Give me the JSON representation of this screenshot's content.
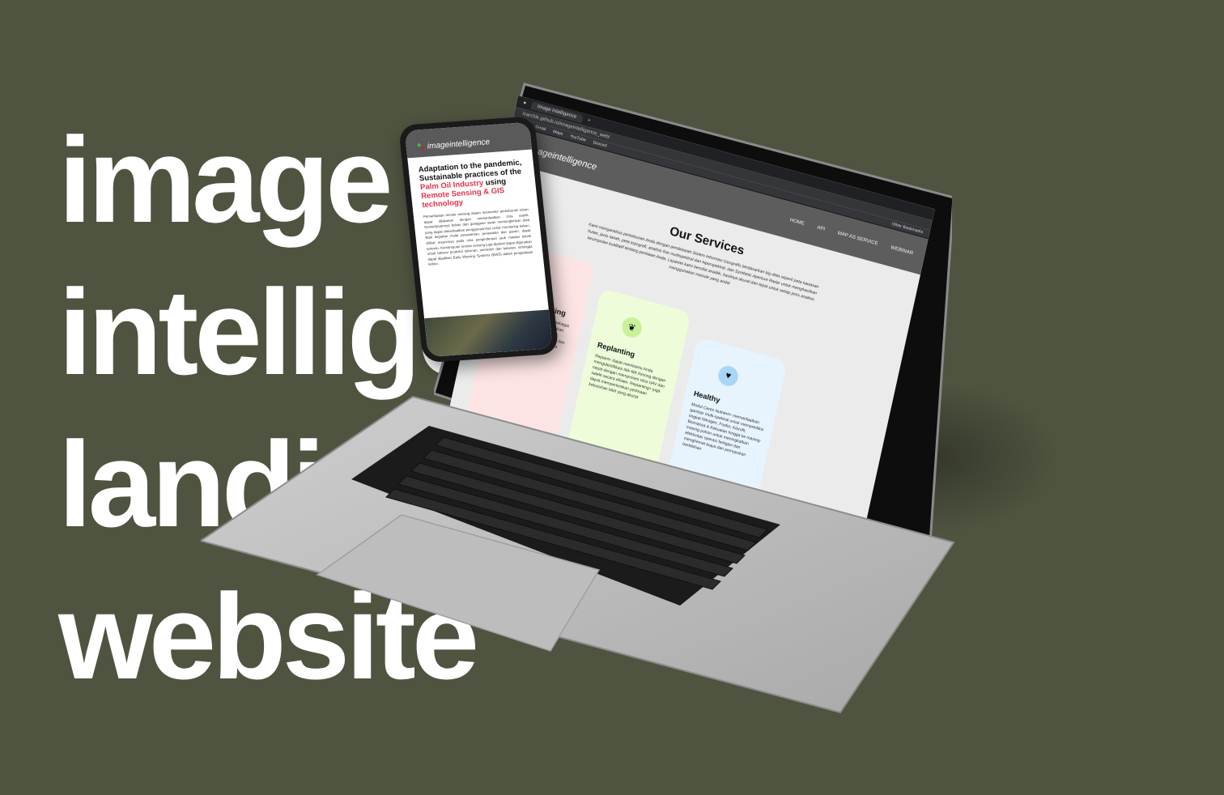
{
  "headline": {
    "lines": [
      "image",
      "intelligence",
      "landing page",
      "website"
    ]
  },
  "browser": {
    "tab_title": "Image Intelligence",
    "url": "icarchik.github.io/imageintelligence_web/",
    "bookmarks": [
      "Apps",
      "Gmail",
      "Maps",
      "YouTube",
      "Discord"
    ],
    "other_bookmarks": "Other Bookmarks"
  },
  "site": {
    "logo": "imageintelligence",
    "nav": [
      "HOME",
      "API",
      "MAP AS SERVICE",
      "WEBINAR"
    ],
    "services_title": "Our Services",
    "services_desc": "Kami menganalisis perkebunan Anda dengan pendekatan Sistem Informasi Geografis berdasarkan big data seperti peta kawasan hutan, jenis tanah, peta topografi, analisis foto multispektral dan hiperspektral, dan Synthetic Aperture Radar untuk menghasilkan kesimpulan kualitatif tentang penilaian Anda. Layanan kami bersifat analitik, hasilnya akurat dan tepat untuk setiap jenis analisis menggunakan metode yang andal",
    "cards": [
      {
        "title": "Agriforest Sensing",
        "text": "Agriforest Sensing adalah Peta sebagai layanan untuk mengimplementasikan citra UAV, citra satelit dan data Big Geospasial, untuk mengidentifikasi dan menandai setiap pohon unik secara akurat.",
        "color": "#fde4e4",
        "icon_color": "#f4a9a9",
        "icon": "satellite-icon"
      },
      {
        "title": "Replanting",
        "text": "Replant+ dapat membantu Anda mengidentifikasi titik-titik kosong dengan cepat dengan memproses citra UAV dan satelit secara efisien. Replanting+ juga dapat memperkirakan perkiraan kebutuhan bibit yang akurat",
        "color": "#eefcd9",
        "icon_color": "#c8f29a",
        "icon": "sprout-icon"
      },
      {
        "title": "Healthy",
        "text": "Modul Ceres Nutrient+ memanfaatkan gambar multi-spektral untuk memprediksi tingkat Nitrogen, Fosfor, Klorofil, Biomassa & Kekuatan hingga ke masing-masing pohon untuk meningkatkan efektivitas operasi fertigasi dan menghemat biaya dari pemupukan berlebihan",
        "color": "#e7f4fd",
        "icon_color": "#a9d6f5",
        "icon": "health-icon"
      }
    ]
  },
  "phone": {
    "logo": "imageintelligence",
    "title_part1": "Adaptation to the pandemic, Sustainable practices of the ",
    "title_highlight": "Palm Oil Industry",
    "title_part2": " using ",
    "title_highlight2": "Remote Sensing & GIS technology",
    "body": "Pemanfaatan remote sensing dalam memonitor perkebunan lahan dapat dilakukan dengan memanfaatkan citra satelit. Kemampuannya bebas dari gangguan awan memungkinkan data yang dapat dimanfaatkan penggunaannya untuk monitoring kebun. Baik kegiatan mulai penanaman, perawatan dan panen, dapat dilihat responnya pada citra penginderaan jauh melalui teknik tertentu. Kemampuan remote sensing juga diyakini dapat digunakan untuk taksasi produksi tahunan, semester dan bulanan, sehingga dapat dijadikan Early Warning Systems (EWS) dalam pengelolaan kebun."
  },
  "colors": {
    "background": "#4f5440",
    "headline": "#ffffff",
    "accent": "#e2324a"
  }
}
